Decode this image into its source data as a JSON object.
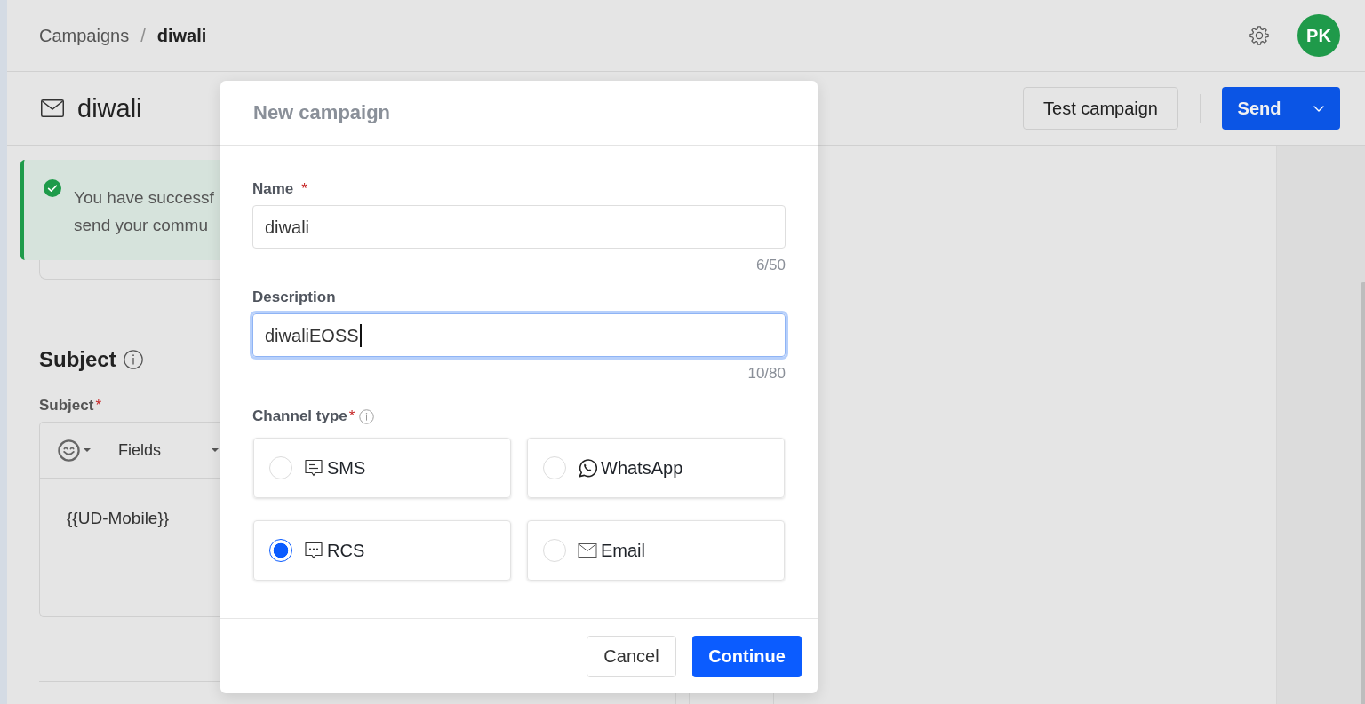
{
  "breadcrumb": {
    "parent": "Campaigns",
    "separator": "/",
    "current": "diwali"
  },
  "user": {
    "initials": "PK"
  },
  "campaign": {
    "title": "diwali",
    "test_button": "Test campaign",
    "send_button": "Send"
  },
  "alert": {
    "kind": "success",
    "lines": [
      "You have successf",
      "send your commu"
    ]
  },
  "subject": {
    "heading": "Subject",
    "label": "Subject",
    "required_mark": "*",
    "toolbar_label": "Fields",
    "value": "{{UD-Mobile}}"
  },
  "modal": {
    "title": "New campaign",
    "fields": [
      {
        "label": "Name",
        "required_mark": "*",
        "value": "diwali",
        "counter": "6/50",
        "focused": false
      },
      {
        "label": "Description",
        "value": "diwaliEOSS",
        "counter": "10/80",
        "focused": true
      }
    ],
    "channel_type": {
      "label": "Channel type",
      "required_mark": "*",
      "options": [
        {
          "kind": "sms",
          "label": "SMS",
          "selected": false
        },
        {
          "kind": "whatsapp",
          "label": "WhatsApp",
          "selected": false
        },
        {
          "kind": "rcs",
          "label": "RCS",
          "selected": true
        },
        {
          "kind": "email",
          "label": "Email",
          "selected": false
        }
      ]
    },
    "buttons": {
      "cancel": "Cancel",
      "continue": "Continue"
    }
  }
}
